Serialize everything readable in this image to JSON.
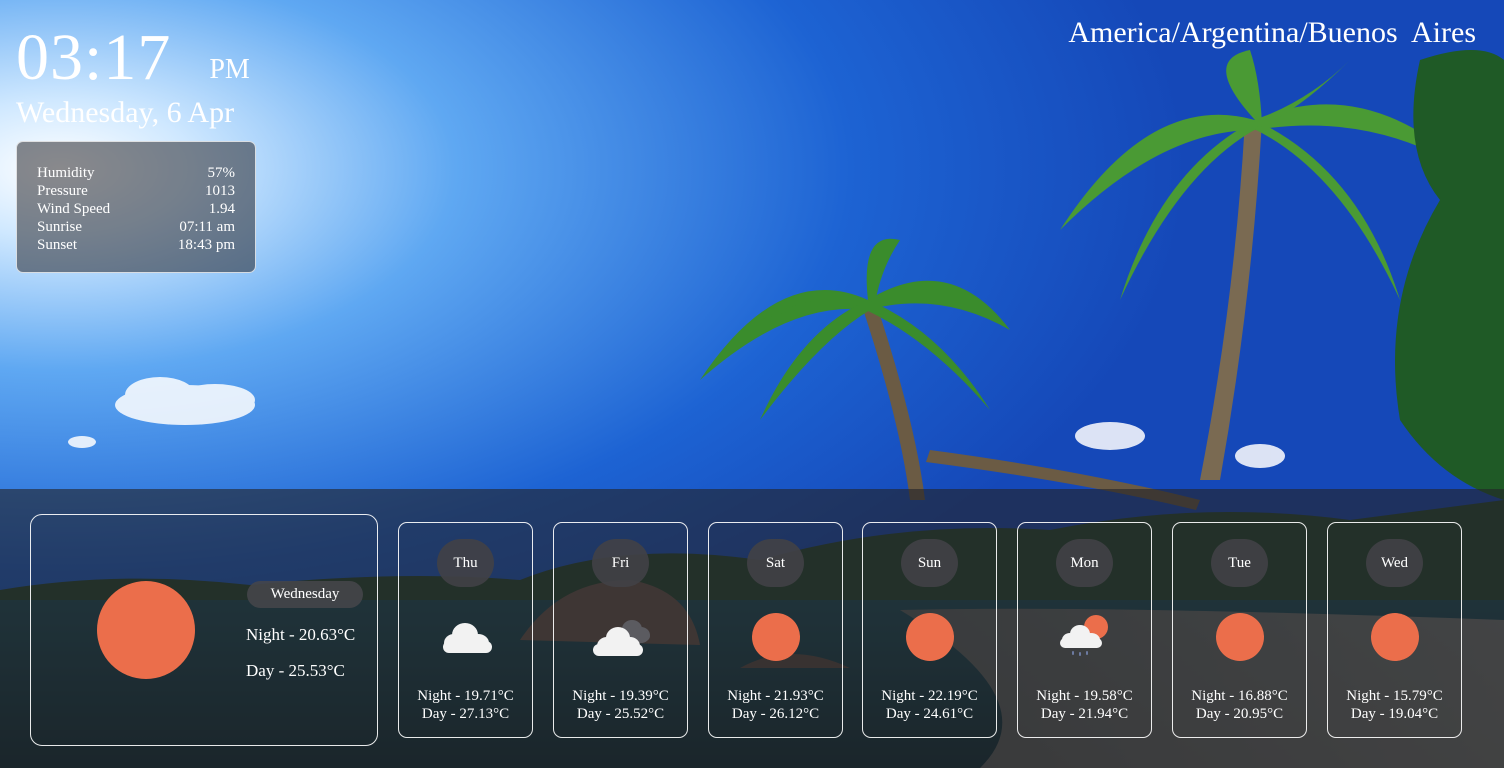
{
  "clock": {
    "time": "03:17",
    "ampm": "PM",
    "date": "Wednesday, 6 Apr"
  },
  "timezone": "America/Argentina/Buenos  Aires",
  "info": [
    {
      "label": "Humidity",
      "value": "57%"
    },
    {
      "label": "Pressure",
      "value": "1013"
    },
    {
      "label": "Wind Speed",
      "value": "1.94"
    },
    {
      "label": "Sunrise",
      "value": "07:11 am"
    },
    {
      "label": "Sunset",
      "value": "18:43 pm"
    }
  ],
  "today": {
    "day": "Wednesday",
    "night": "Night - 20.63°C",
    "daytemp": "Day - 25.53°C",
    "icon": "sun-icon"
  },
  "forecast": [
    {
      "day": "Thu",
      "night": "Night - 19.71°C",
      "daytemp": "Day - 27.13°C",
      "icon": "cloud-icon"
    },
    {
      "day": "Fri",
      "night": "Night - 19.39°C",
      "daytemp": "Day - 25.52°C",
      "icon": "clouds-icon"
    },
    {
      "day": "Sat",
      "night": "Night - 21.93°C",
      "daytemp": "Day - 26.12°C",
      "icon": "sun-icon"
    },
    {
      "day": "Sun",
      "night": "Night - 22.19°C",
      "daytemp": "Day - 24.61°C",
      "icon": "sun-icon"
    },
    {
      "day": "Mon",
      "night": "Night - 19.58°C",
      "daytemp": "Day - 21.94°C",
      "icon": "sun-cloud-rain-icon"
    },
    {
      "day": "Tue",
      "night": "Night - 16.88°C",
      "daytemp": "Day - 20.95°C",
      "icon": "sun-icon"
    },
    {
      "day": "Wed",
      "night": "Night - 15.79°C",
      "daytemp": "Day - 19.04°C",
      "icon": "sun-icon"
    }
  ],
  "colors": {
    "sun": "#eb6e4b",
    "cloud": "#f2f2f2",
    "cloud_dark": "#5b5b60"
  }
}
